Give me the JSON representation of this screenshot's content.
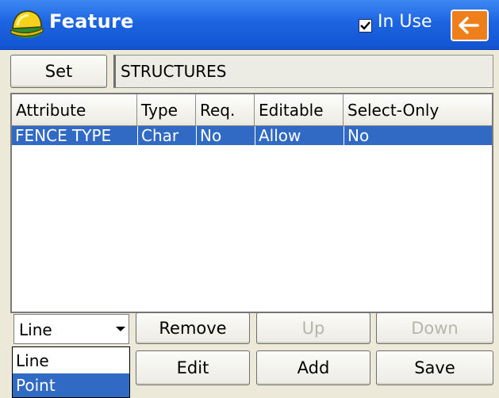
{
  "window": {
    "title": "Feature",
    "in_use_label": "In Use",
    "in_use_checked": true,
    "back_icon": "left-arrow-icon",
    "app_icon": "hard-hat-icon"
  },
  "feature": {
    "set_label": "Set",
    "name": "STRUCTURES"
  },
  "table": {
    "columns": [
      "Attribute",
      "Type",
      "Req.",
      "Editable",
      "Select-Only"
    ],
    "rows": [
      {
        "attribute": "FENCE TYPE",
        "type": "Char",
        "req": "No",
        "editable": "Allow",
        "select_only": "No",
        "selected": true
      }
    ]
  },
  "geometry": {
    "selected_value": "Line",
    "options": [
      "Line",
      "Point"
    ],
    "highlighted_option": "Point"
  },
  "buttons": {
    "remove": "Remove",
    "up": "Up",
    "down": "Down",
    "edit": "Edit",
    "add": "Add",
    "save": "Save"
  },
  "colors": {
    "titlebar": "#1c64e2",
    "selection": "#316ac5",
    "back_button": "#ef7f1a"
  }
}
